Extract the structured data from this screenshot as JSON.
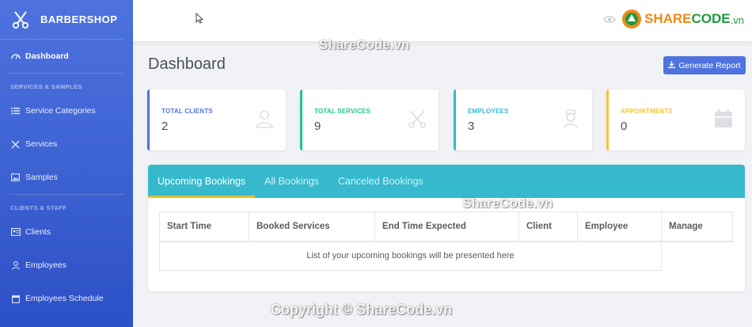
{
  "brand": {
    "name": "BARBERSHOP"
  },
  "sidebar": {
    "dashboard": "Dashboard",
    "heading_services": "SERVICES & SAMPLES",
    "service_categories": "Service Categories",
    "services": "Services",
    "samples": "Samples",
    "heading_clients": "CLIENTS & STAFF",
    "clients": "Clients",
    "employees": "Employees",
    "employees_schedule": "Employees Schedule"
  },
  "page": {
    "title": "Dashboard",
    "generate_report": "Generate Report"
  },
  "cards": [
    {
      "label": "TOTAL CLIENTS",
      "value": "2",
      "color": "#4e73df"
    },
    {
      "label": "TOTAL SERVICES",
      "value": "9",
      "color": "#1cc88a"
    },
    {
      "label": "EMPLOYEES",
      "value": "3",
      "color": "#36b9cc"
    },
    {
      "label": "APPOINTMENTS",
      "value": "0",
      "color": "#f6c23e"
    }
  ],
  "tabs": [
    "Upcoming Bookings",
    "All Bookings",
    "Canceled Bookings"
  ],
  "table": {
    "columns": [
      "Start Time",
      "Booked Services",
      "End Time Expected",
      "Client",
      "Employee",
      "Manage"
    ],
    "empty_message": "List of your upcoming bookings will be presented here"
  },
  "watermarks": {
    "logo_a": "SHARE",
    "logo_b": "CODE",
    "logo_c": ".vn",
    "wm_top": "ShareCode.vn",
    "wm_mid": "ShareCode.vn",
    "wm_bottom": "Copyright © ShareCode.vn"
  },
  "colors": {
    "primary": "#4e73df",
    "info": "#36b9cc",
    "success": "#1cc88a",
    "warning": "#f6c23e"
  }
}
